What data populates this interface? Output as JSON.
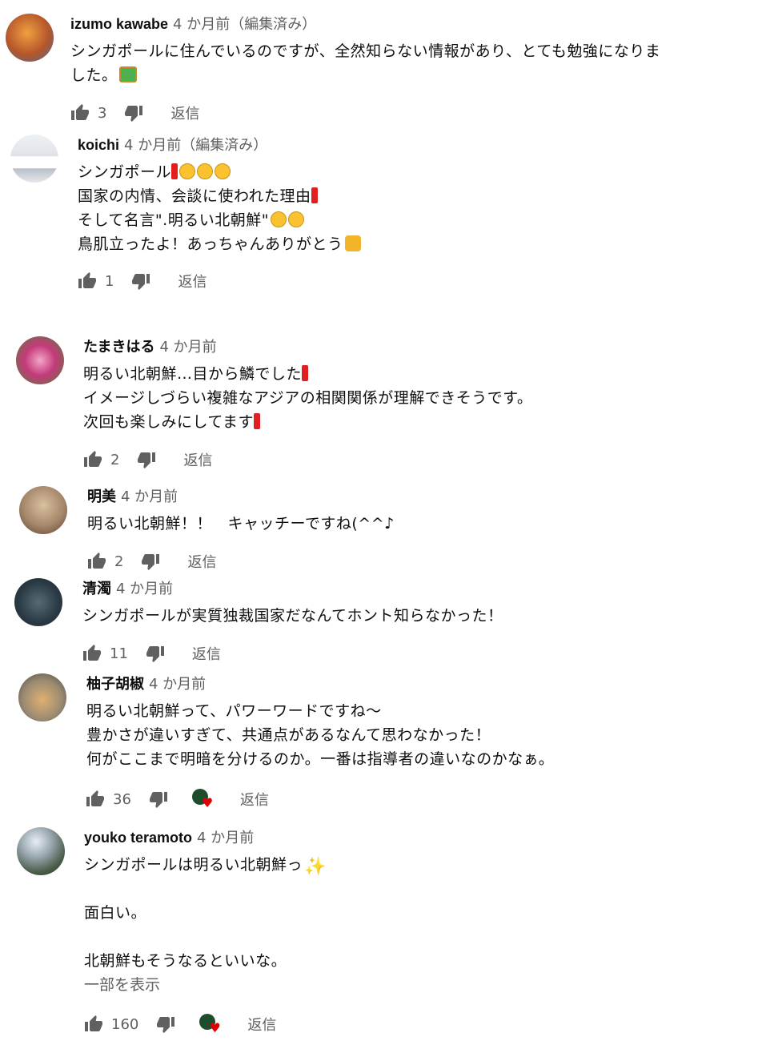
{
  "comments": [
    {
      "author": "izumo kawabe",
      "time": "4 か月前（編集済み）",
      "lines": [
        "シンガポールに住んでいるのですが、全然知らない情報があり、とても勉強になりま",
        "した。"
      ],
      "emoji": [
        "teacher-emoji"
      ],
      "likes": "3",
      "reply": "返信",
      "hearted": false,
      "avatar_color": "#b5562a"
    },
    {
      "author": "koichi",
      "time": "4 か月前（編集済み）",
      "lines": [
        "シンガポール",
        "国家の内情、会談に使われた理由",
        "そして名言\".明るい北朝鮮\"",
        "鳥肌立ったよ！あっちゃんありがとう"
      ],
      "likes": "1",
      "reply": "返信",
      "hearted": false,
      "avatar_color": "#d9dde2"
    },
    {
      "author": "たまきはる",
      "time": "4 か月前",
      "lines": [
        "明るい北朝鮮…目から鱗でした",
        "イメージしづらい複雑なアジアの相関関係が理解できそうです。",
        "次回も楽しみにしてます"
      ],
      "likes": "2",
      "reply": "返信",
      "hearted": false,
      "avatar_color": "#c43a7a"
    },
    {
      "author": "明美",
      "time": "4 か月前",
      "lines": [
        "明るい北朝鮮！！　キャッチーですね(^^♪"
      ],
      "likes": "2",
      "reply": "返信",
      "hearted": false,
      "avatar_color": "#a5876a"
    },
    {
      "author": "清濁",
      "time": "4 か月前",
      "lines": [
        "シンガポールが実質独裁国家だなんてホント知らなかった！"
      ],
      "likes": "11",
      "reply": "返信",
      "hearted": false,
      "avatar_color": "#2a3a44"
    },
    {
      "author": "柚子胡椒",
      "time": "4 か月前",
      "lines": [
        "明るい北朝鮮って、パワーワードですね～",
        "豊かさが違いすぎて、共通点があるなんて思わなかった！",
        "何がここまで明暗を分けるのか。一番は指導者の違いなのかなぁ。"
      ],
      "likes": "36",
      "reply": "返信",
      "hearted": true,
      "avatar_color": "#9a8a72"
    },
    {
      "author": "youko teramoto",
      "time": "4 か月前",
      "lines": [
        "シンガポールは明るい北朝鮮っ",
        "",
        "面白い。",
        "",
        "北朝鮮もそうなるといいな。"
      ],
      "more": "一部を表示",
      "likes": "160",
      "reply": "返信",
      "hearted": true,
      "avatar_color": "#4a5c48"
    }
  ]
}
